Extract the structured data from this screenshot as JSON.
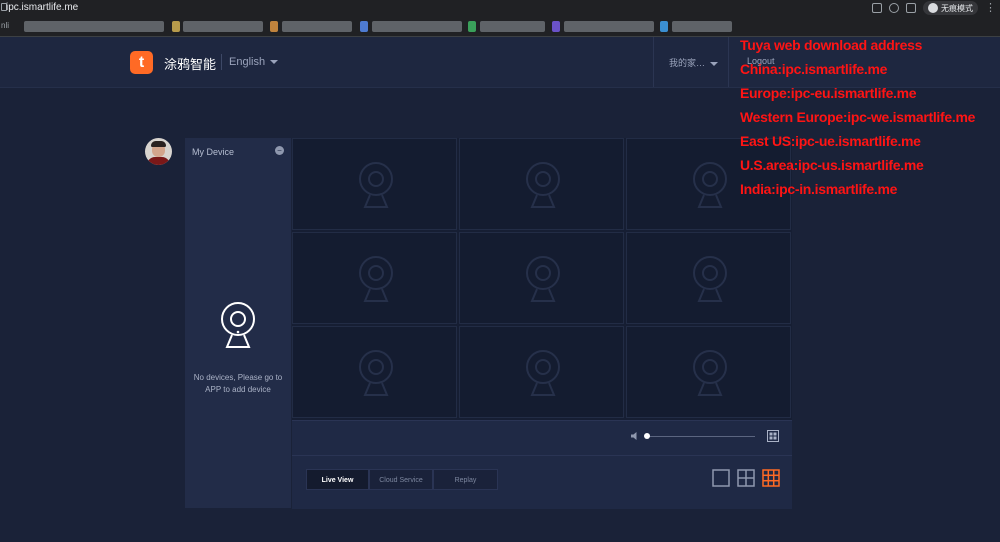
{
  "browser": {
    "url": "ipc.ismartlife.me",
    "incognito_label": "无痕模式",
    "bookmark_prefix": "nli",
    "colors": {
      "chrome": "#202124",
      "text": "#e8eaed"
    }
  },
  "header": {
    "logo_letter": "t",
    "brand": "涂鸦智能",
    "language": "English",
    "home": "我的家…",
    "logout": "Logout"
  },
  "sidebar": {
    "title": "My Device",
    "empty_message": "No devices, Please go to APP to add device"
  },
  "player": {
    "volume_percent": 0,
    "grid_cells": 9
  },
  "tabs": [
    {
      "label": "Live View",
      "active": true
    },
    {
      "label": "Cloud Service",
      "active": false
    },
    {
      "label": "Replay",
      "active": false
    }
  ],
  "layouts": [
    {
      "name": "1x1",
      "active": false
    },
    {
      "name": "2x2",
      "active": false
    },
    {
      "name": "3x3",
      "active": true
    }
  ],
  "annotation": {
    "lines": [
      "Tuya web download address",
      "China:ipc.ismartlife.me",
      "Europe:ipc-eu.ismartlife.me",
      "Western Europe:ipc-we.ismartlife.me",
      "East US:ipc-ue.ismartlife.me",
      "U.S.area:ipc-us.ismartlife.me",
      "India:ipc-in.ismartlife.me"
    ],
    "color": "#ff1414"
  },
  "colors": {
    "accent": "#ff6a25",
    "background": "#1a2238",
    "panel": "#222c48"
  }
}
